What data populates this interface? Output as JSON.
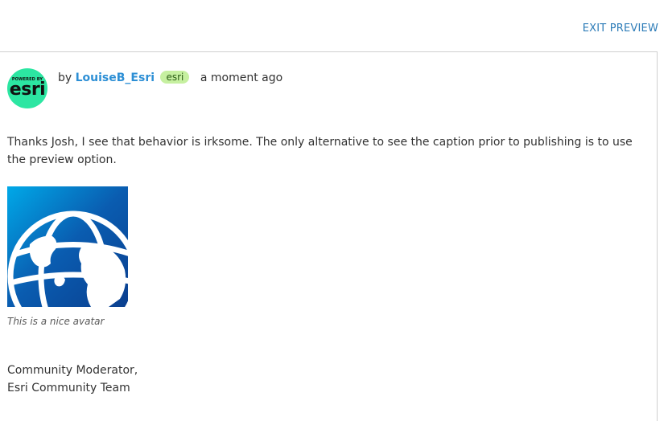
{
  "header": {
    "exit_preview_label": "EXIT PREVIEW"
  },
  "post": {
    "avatar": {
      "powered_by": "POWERED BY",
      "logo_text": "esri",
      "bg_color": "#2ce6a2"
    },
    "by_prefix": "by",
    "author": "LouiseB_Esri",
    "badge": "esri",
    "timestamp": "a moment ago",
    "body": "Thanks Josh, I see that behavior is irksome. The only alternative to see the caption prior to publishing is to use the preview option.",
    "image_caption": "This is a nice avatar",
    "signature_line1": "Community Moderator,",
    "signature_line2": "Esri Community Team"
  },
  "colors": {
    "link_blue": "#2d8fd5",
    "badge_green": "#c6f0a0",
    "image_blue": "#0a5cb0"
  }
}
